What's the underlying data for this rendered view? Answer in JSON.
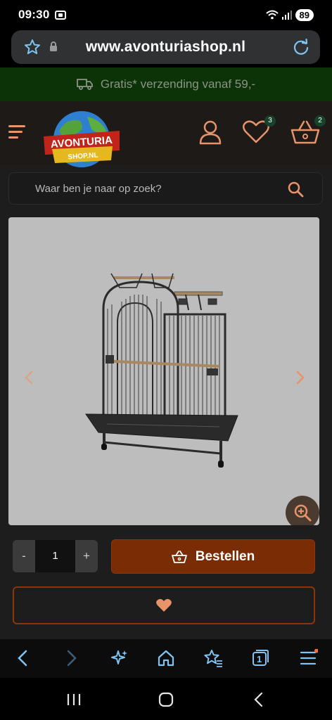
{
  "status_bar": {
    "time": "09:30",
    "battery": "89"
  },
  "browser": {
    "url": "www.avonturiashop.nl",
    "tab_count": "1"
  },
  "site": {
    "promo_text": "Gratis* verzending vanaf 59,-",
    "logo_line1": "AVONTURIA",
    "logo_line2": "SHOP.NL",
    "wishlist_count": "3",
    "cart_count": "2",
    "search_placeholder": "Waar ben je naar op zoek?",
    "quantity_minus": "-",
    "quantity_value": "1",
    "quantity_plus": "+",
    "order_label": "Bestellen"
  },
  "colors": {
    "accent": "#e8936a",
    "order_button": "#7a2c05",
    "promo_bg": "#0c3208",
    "badge": "#16432a"
  },
  "icons": [
    "star-icon",
    "lock-icon",
    "reload-icon",
    "truck-icon",
    "hamburger-menu-icon",
    "user-icon",
    "heart-icon",
    "basket-icon",
    "search-icon",
    "chevron-left-icon",
    "chevron-right-icon",
    "zoom-in-icon",
    "back-icon",
    "forward-icon",
    "sparkle-icon",
    "home-icon",
    "bookmark-star-icon",
    "tabs-icon",
    "menu-icon"
  ]
}
